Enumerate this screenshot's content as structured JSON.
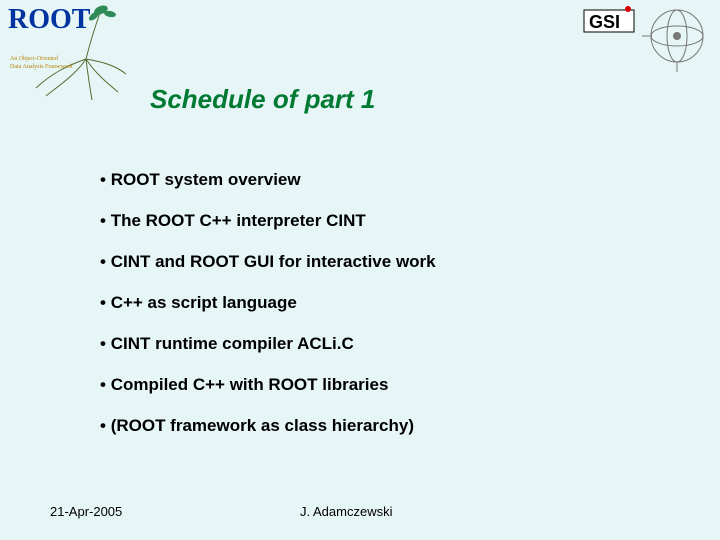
{
  "logos": {
    "root": {
      "text": "ROOT"
    },
    "gsi": {
      "text": "GSI"
    }
  },
  "title": "Schedule of part 1",
  "bullets": [
    "ROOT system overview",
    "The ROOT C++ interpreter CINT",
    "CINT and ROOT GUI for interactive work",
    "C++ as script language",
    "CINT runtime compiler ACLi.C",
    "Compiled C++ with ROOT libraries",
    "(ROOT framework as class hierarchy)"
  ],
  "footer": {
    "date": "21-Apr-2005",
    "author": "J. Adamczewski"
  }
}
